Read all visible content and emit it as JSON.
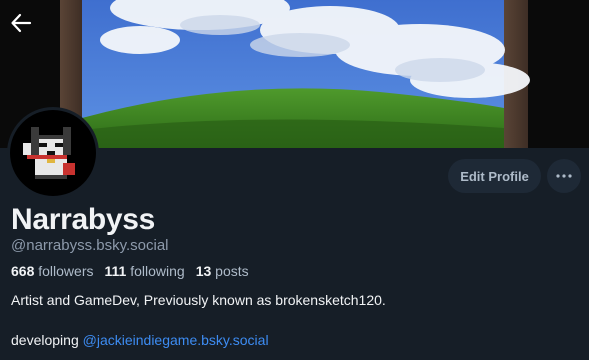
{
  "profile": {
    "display_name": "Narrabyss",
    "handle": "@narrabyss.bsky.social",
    "followers_count": "668",
    "followers_label": "followers",
    "following_count": "111",
    "following_label": "following",
    "posts_count": "13",
    "posts_label": "posts",
    "bio_line1": "Artist and GameDev, Previously known as brokensketch120.",
    "bio_line2_prefix": "developing",
    "bio_line2_link": "@jackieindiegame.bsky.social"
  },
  "actions": {
    "edit_profile_label": "Edit Profile"
  },
  "icons": {
    "back": "arrow-left-icon",
    "more": "ellipsis-icon"
  },
  "colors": {
    "background": "#161e27",
    "button_bg": "#1e2936",
    "link": "#3d8cf2",
    "muted_text": "#8d9aab"
  }
}
